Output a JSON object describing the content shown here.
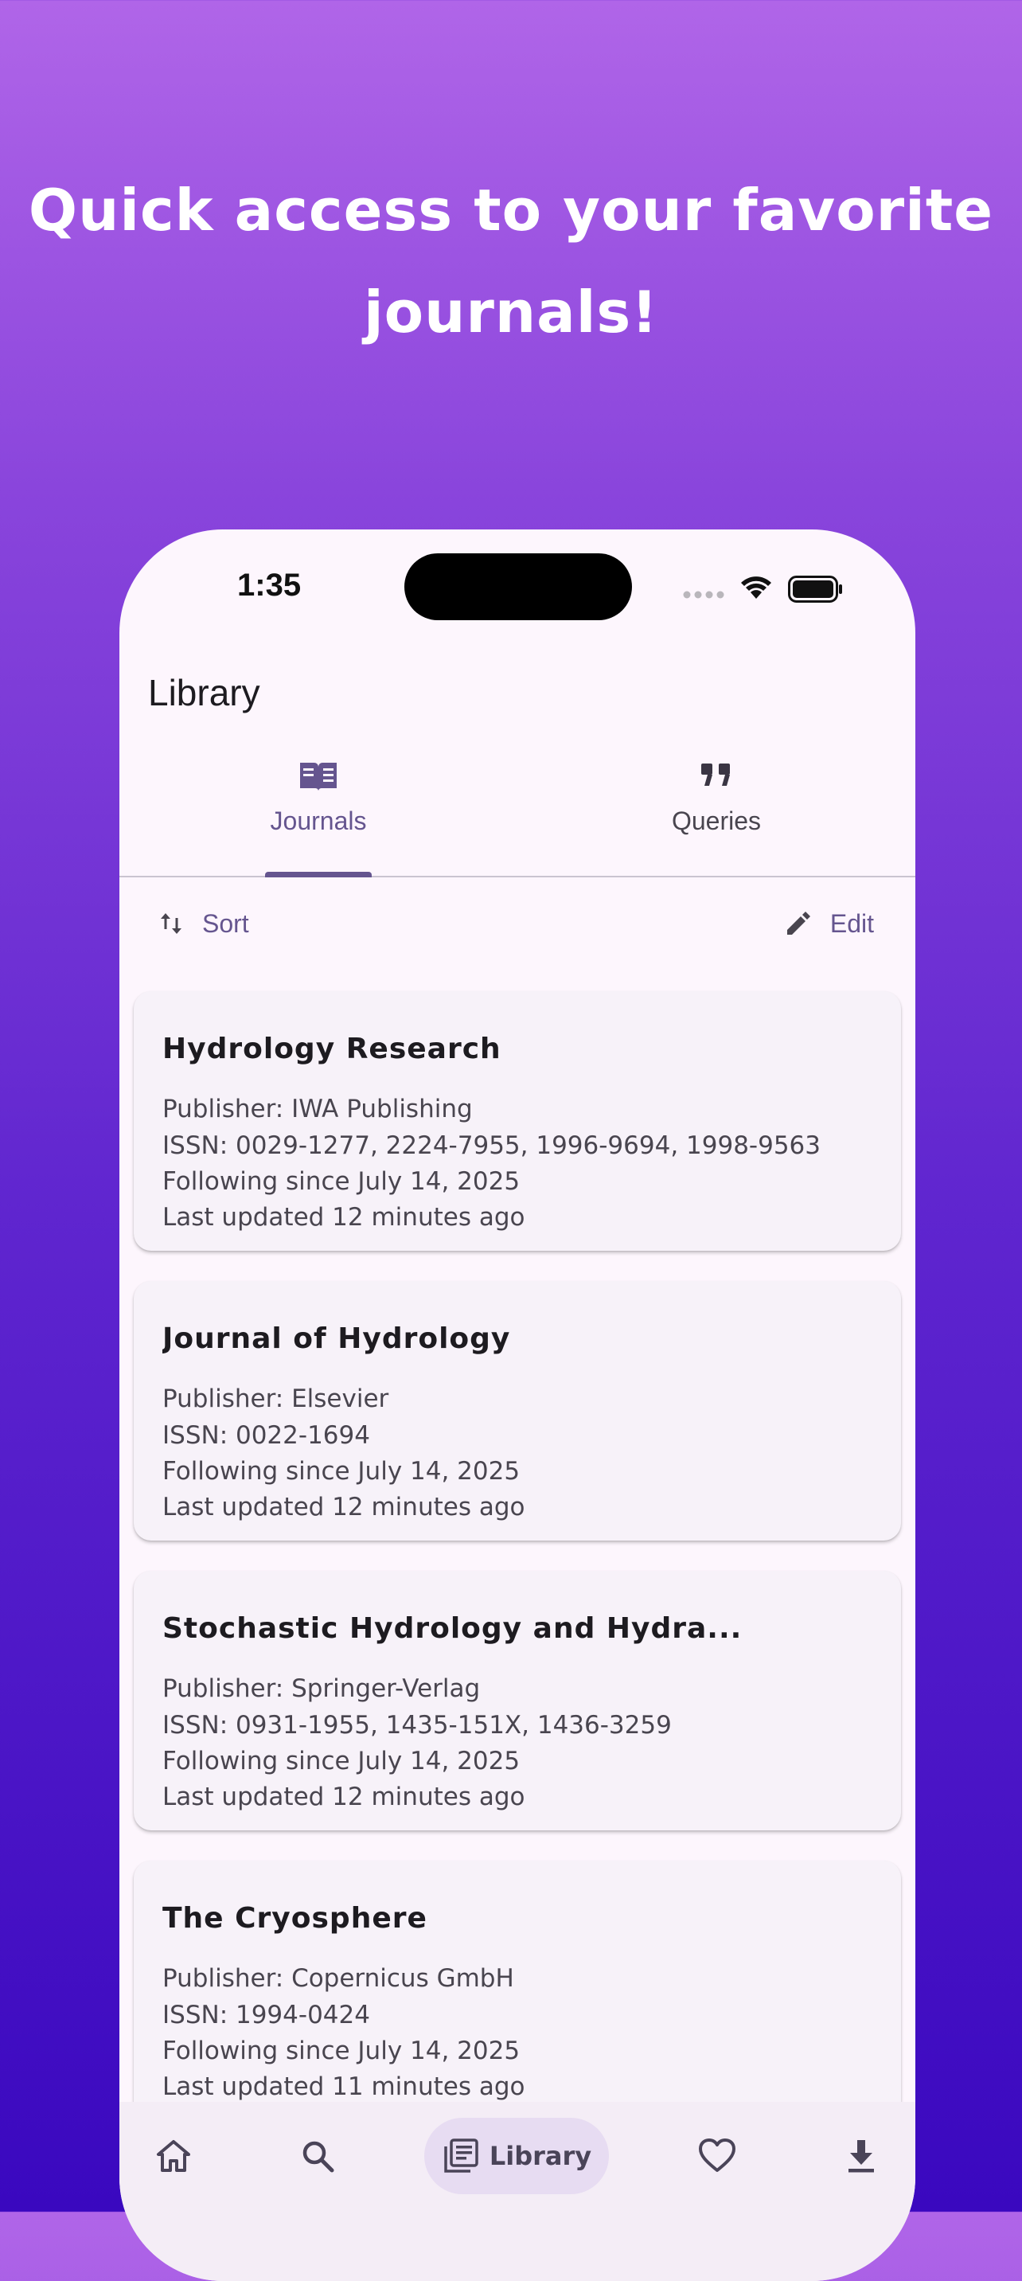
{
  "headline": {
    "line1": "Quick access to your favorite",
    "line2": "journals!"
  },
  "status_bar": {
    "time": "1:35"
  },
  "app": {
    "title": "Library",
    "tabs": [
      {
        "label": "Journals",
        "icon": "book-open-icon",
        "selected": true
      },
      {
        "label": "Queries",
        "icon": "quote-icon",
        "selected": false
      }
    ],
    "actions": {
      "sort_label": "Sort",
      "edit_label": "Edit"
    },
    "journals": [
      {
        "title": "Hydrology Research",
        "publisher": "Publisher: IWA Publishing",
        "issn": "ISSN: 0029-1277, 2224-7955, 1996-9694, 1998-9563",
        "following": "Following since July 14, 2025",
        "updated": "Last updated 12 minutes ago"
      },
      {
        "title": "Journal of Hydrology",
        "publisher": "Publisher: Elsevier",
        "issn": "ISSN: 0022-1694",
        "following": "Following since July 14, 2025",
        "updated": "Last updated 12 minutes ago"
      },
      {
        "title": "Stochastic Hydrology and Hydra...",
        "publisher": "Publisher: Springer-Verlag",
        "issn": "ISSN: 0931-1955, 1435-151X, 1436-3259",
        "following": "Following since July 14, 2025",
        "updated": "Last updated 12 minutes ago"
      },
      {
        "title": "The Cryosphere",
        "publisher": "Publisher: Copernicus GmbH",
        "issn": "ISSN: 1994-0424",
        "following": "Following since July 14, 2025",
        "updated": "Last updated 11 minutes ago"
      }
    ],
    "nav": {
      "items": [
        {
          "icon": "home-icon"
        },
        {
          "icon": "search-icon"
        },
        {
          "icon": "library-icon",
          "label": "Library",
          "selected": true
        },
        {
          "icon": "heart-icon"
        },
        {
          "icon": "download-icon"
        }
      ]
    }
  },
  "colors": {
    "accent": "#65558f",
    "surface": "#fdf6fd",
    "card": "#f7f2f9",
    "nav_selected": "#e7dcf2",
    "gradient_top": "#b065e8",
    "gradient_bottom": "#3a08bf"
  }
}
